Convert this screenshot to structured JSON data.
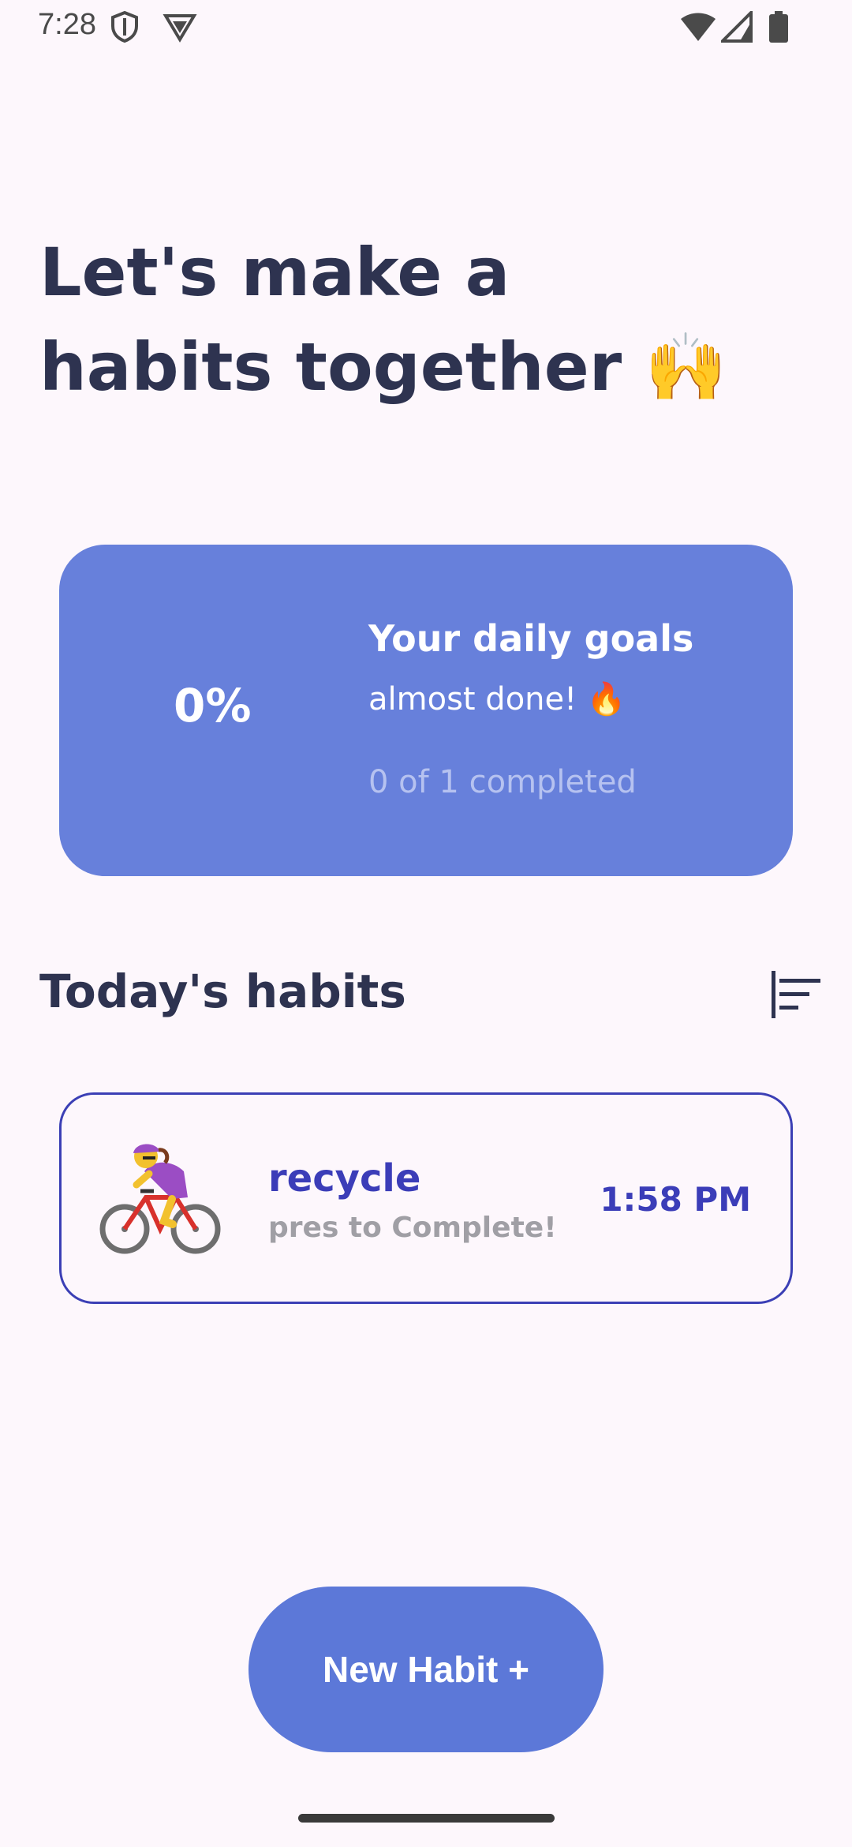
{
  "status_bar": {
    "time": "7:28",
    "icons": [
      "shield-icon",
      "vpn-icon",
      "wifi-icon",
      "signal-icon",
      "battery-icon"
    ]
  },
  "header": {
    "line1": "Let's make a",
    "line2": "habits together",
    "emoji": "🙌"
  },
  "goal_card": {
    "percent": "0%",
    "progress_fraction": 0,
    "title": "Your daily goals",
    "subtitle": "almost done! 🔥",
    "progress_text": "0 of 1 completed",
    "color": "#6780db"
  },
  "habits_section": {
    "title": "Today's habits",
    "sort_icon": "sort-icon"
  },
  "habits": [
    {
      "name": "recycle",
      "hint": "pres to Complete!",
      "time": "1:58 PM",
      "icon": "woman-biking-icon"
    }
  ],
  "fab": {
    "label": "New Habit +"
  },
  "colors": {
    "background": "#fdf7fc",
    "accent": "#3b3db8",
    "fab": "#5c78d8"
  }
}
